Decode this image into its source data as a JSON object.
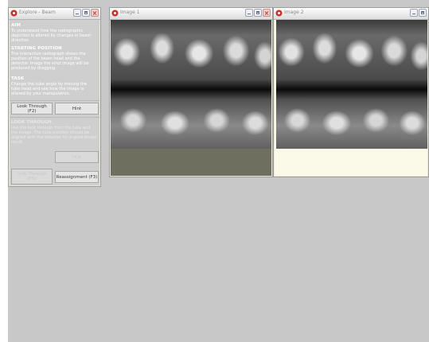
{
  "explore_window": {
    "title": "Explore - Beam",
    "aim": {
      "heading": "AIM",
      "text": "To understand how the radiographic depiction is altered by changes in beam direction."
    },
    "starting_position": {
      "heading": "STARTING POSITION",
      "text": "The interactive radiograph shows the position of the beam head and the detector. Image the strut image will be produced by dragging."
    },
    "task": {
      "heading": "TASK",
      "text": "Change the tube angle by moving the tube head and see how the image is altered by your manipulation."
    },
    "buttons": {
      "look_through": "Look Through (F2)",
      "hint": "Hint",
      "hint2": "Hint",
      "look_through_cmd": "Look Through (F5)",
      "reassignment": "Reassignment (F3)"
    },
    "second_task": {
      "heading": "LOOK THROUGH",
      "text": "Use the look through from the tube and the image. The tube position should be aligned with the detector for a good image result."
    }
  },
  "image_windows": [
    {
      "title": "Image 1"
    },
    {
      "title": "Image 2"
    }
  ],
  "colors": {
    "desktop": "#c8c8c8",
    "panel": "#cfcfcf",
    "image1_bottom": "#6f6f5f",
    "image2_bottom": "#fbfae8"
  },
  "icons": [
    "app-icon",
    "minimize-icon",
    "maximize-icon",
    "close-icon"
  ]
}
